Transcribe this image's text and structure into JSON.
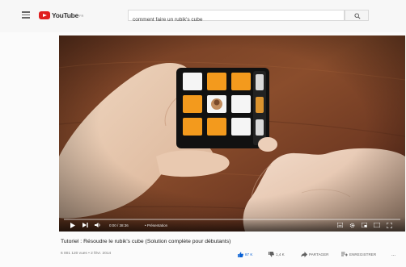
{
  "header": {
    "logo_text": "YouTube",
    "logo_region": "FR",
    "search_value": "comment faire un rubik's cube"
  },
  "player": {
    "time": "0:00 / 38:36",
    "chapter": "• Présentation",
    "progress_fraction": 0.0
  },
  "video": {
    "title": "Tutoriel : Résoudre le rubik's cube (Solution complète pour débutants)",
    "meta": "6 001 120 vues • 2 févr. 2014",
    "actions": {
      "like": "87 K",
      "dislike": "1,4 K",
      "share": "PARTAGER",
      "save": "ENREGISTRER",
      "more": "..."
    }
  },
  "colors": {
    "accent": "#e02020",
    "like_active": "#065fd4"
  }
}
